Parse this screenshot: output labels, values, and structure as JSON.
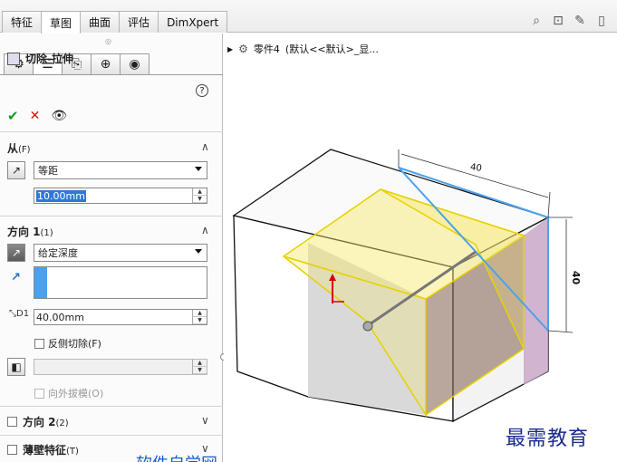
{
  "tabs": [
    "特征",
    "草图",
    "曲面",
    "评估",
    "DimXpert"
  ],
  "active_tab": "草图",
  "tree": {
    "part_label": "零件4",
    "config": "(默认<<默认>_显..."
  },
  "feature": {
    "title": "切除-拉伸",
    "help": "?"
  },
  "from_section": {
    "title": "从",
    "shortcut": "(F)",
    "select_value": "等距",
    "offset_value": "10.00mm"
  },
  "direction1": {
    "title": "方向 1",
    "shortcut": "(1)",
    "select_value": "给定深度",
    "depth_value": "40.00mm",
    "reverse_label": "反侧切除(F)",
    "draft_outward_label": "向外拔模(O)"
  },
  "direction2": {
    "title": "方向 2",
    "shortcut": "(2)"
  },
  "thin_feature": {
    "title": "薄壁特征",
    "shortcut": "(T)"
  },
  "dimensions": {
    "width": "40",
    "height": "40"
  },
  "watermark": "最需教育",
  "bottom_text": "软件自学网",
  "colors": {
    "accent": "#4aa1ee",
    "ok": "#1a9a1a",
    "cancel": "#cc1111",
    "preview": "#f6e96b"
  }
}
